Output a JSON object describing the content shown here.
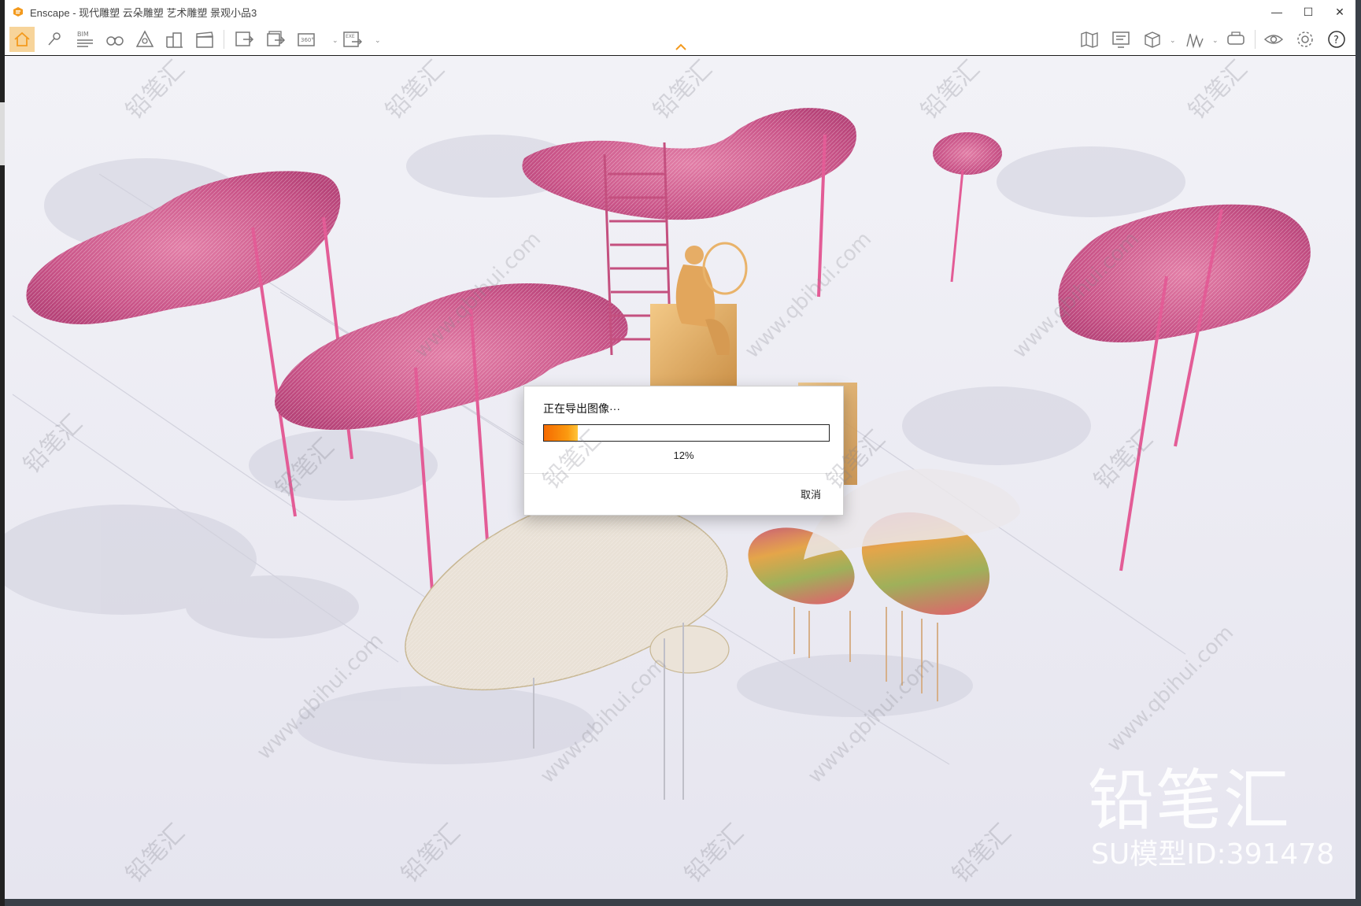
{
  "window": {
    "app_name": "Enscape",
    "title": "Enscape - 现代雕塑 云朵雕塑 艺术雕塑 景观小品3",
    "minimize_label": "—",
    "maximize_label": "☐",
    "close_label": "✕",
    "accent_color": "#f39a1e"
  },
  "toolbar": {
    "buttons": [
      {
        "name": "home",
        "icon": "home-icon",
        "active": true
      },
      {
        "name": "views",
        "icon": "pin-icon"
      },
      {
        "name": "bim",
        "icon": "bim-icon",
        "label": "BIM"
      },
      {
        "name": "binoculars",
        "icon": "binoculars-icon"
      },
      {
        "name": "atmosphere",
        "icon": "atmosphere-icon"
      },
      {
        "name": "buildings",
        "icon": "buildings-icon"
      },
      {
        "name": "video",
        "icon": "clapper-icon"
      },
      {
        "name": "screenshot",
        "icon": "export-image-icon"
      },
      {
        "name": "batch",
        "icon": "batch-export-icon"
      },
      {
        "name": "panorama",
        "icon": "panorama-icon",
        "label": "360°"
      },
      {
        "name": "exe",
        "icon": "exe-export-icon",
        "label": "EXE"
      },
      {
        "name": "map",
        "icon": "map-icon"
      },
      {
        "name": "monitor",
        "icon": "monitor-icon"
      },
      {
        "name": "asset",
        "icon": "box-icon"
      },
      {
        "name": "chart",
        "icon": "chart-icon"
      },
      {
        "name": "vr",
        "icon": "vr-headset-icon"
      },
      {
        "name": "visibility",
        "icon": "eye-icon"
      },
      {
        "name": "settings",
        "icon": "gear-icon"
      },
      {
        "name": "help",
        "icon": "help-icon",
        "label": "?"
      }
    ]
  },
  "dialog": {
    "title": "正在导出图像···",
    "progress": 0.12,
    "progress_text": "12%",
    "cancel_label": "取消",
    "progress_colors": [
      "#f56a00",
      "#ffc53a"
    ]
  },
  "watermark": {
    "brand": "铅笔汇",
    "model_id": "SU模型ID:391478",
    "site": "www.qbihui.com"
  }
}
